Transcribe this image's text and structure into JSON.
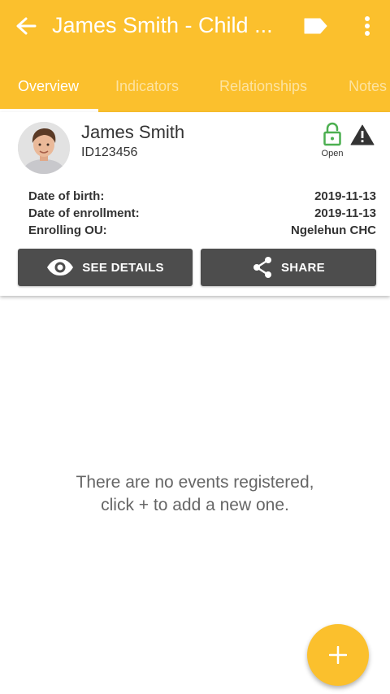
{
  "appbar": {
    "title": "James Smith  - Child ...",
    "color": "#FBC02D",
    "back_icon": "arrow-back-icon",
    "tag_icon": "label-icon",
    "more_icon": "more-vert-icon"
  },
  "tabs": [
    {
      "label": "Overview",
      "active": true
    },
    {
      "label": "Indicators",
      "active": false
    },
    {
      "label": "Relationships",
      "active": false
    },
    {
      "label": "Notes",
      "active": false
    }
  ],
  "profile": {
    "name": "James Smith",
    "id": "ID123456",
    "status_label": "Open",
    "status_color": "#4CAF50"
  },
  "attributes": [
    {
      "label": "Date of birth:",
      "value": "2019-11-13"
    },
    {
      "label": "Date of enrollment:",
      "value": "2019-11-13"
    },
    {
      "label": "Enrolling OU:",
      "value": "Ngelehun CHC"
    }
  ],
  "actions": {
    "details_label": "SEE DETAILS",
    "share_label": "SHARE",
    "button_color": "#4d4d4d"
  },
  "empty_state": {
    "line1": "There are no events registered,",
    "line2": "click + to add a new one."
  },
  "fab": {
    "icon": "plus-icon"
  }
}
